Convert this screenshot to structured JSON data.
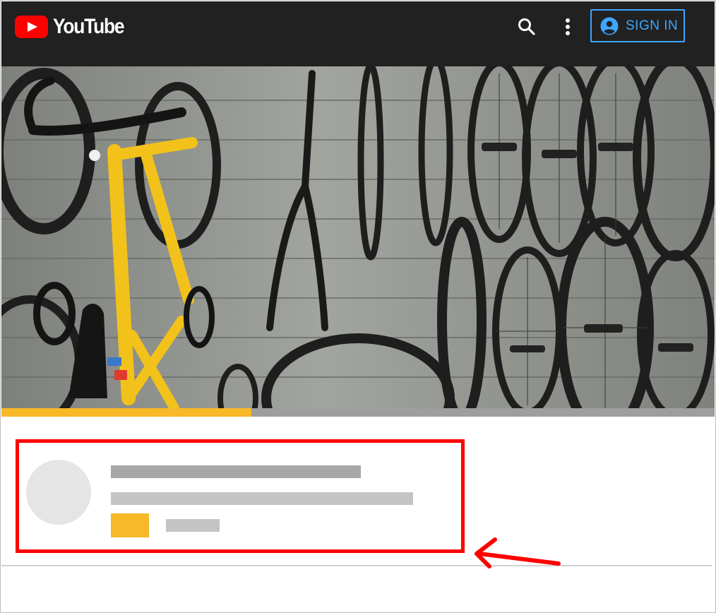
{
  "header": {
    "logo_text": "YouTube",
    "signin_label": "SIGN IN",
    "icons": {
      "logo": "youtube-play-icon",
      "search": "search-icon",
      "menu": "more-vert-icon",
      "account": "account-circle-icon"
    }
  },
  "player": {
    "progress": 0.35,
    "progress_color": "#f7b928",
    "track_color": "#9e9e9e"
  },
  "colors": {
    "topbar": "#212121",
    "accent": "#3ea6ff",
    "brand": "#ff0000",
    "annotation": "#ff0000"
  }
}
